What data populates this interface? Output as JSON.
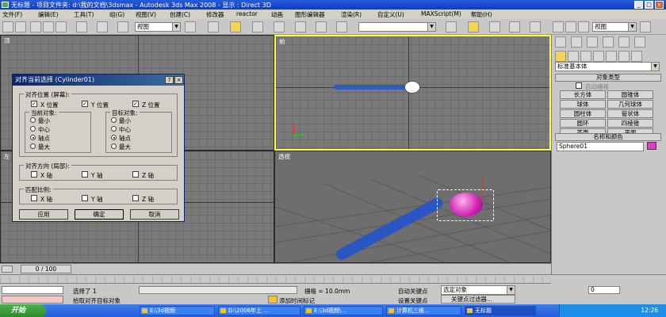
{
  "window": {
    "title": "无标题  - 项目文件夹: d:\\我的文档\\3dsmax    - Autodesk 3ds Max 2008     - 显示 : Direct 3D",
    "min": "_",
    "max": "□",
    "close": "×"
  },
  "menu": [
    "文件(F)",
    "编辑(E)",
    "工具(T)",
    "组(G)",
    "视图(V)",
    "创建(C)",
    "修改器",
    "reactor",
    "动画",
    "图形编辑器",
    "渲染(R)",
    "自定义(U)",
    "MAXScript(M)",
    "帮助(H)"
  ],
  "toolbar": {
    "view_combo": "视图",
    "view_combo_right": "视图"
  },
  "viewports": {
    "top": "顶",
    "front": "前",
    "left": "左",
    "perspective": "透视"
  },
  "command_panel": {
    "category": "标准基本体",
    "object_type_header": "对象类型",
    "autogrid": "自动栅格",
    "objects": [
      "长方体",
      "圆锥体",
      "球体",
      "几何球体",
      "圆柱体",
      "管状体",
      "圆环",
      "四棱锥",
      "茶壶",
      "平面"
    ],
    "name_color_header": "名称和颜色",
    "name_value": "Sphere01",
    "color": "#e040c0"
  },
  "dialog": {
    "title": "对齐当前选择 (Cylinder01)",
    "help": "?",
    "close": "×",
    "align_position": "对齐位置 (屏幕):",
    "x_pos": "X 位置",
    "y_pos": "Y 位置",
    "z_pos": "Z 位置",
    "current_object": "当前对象:",
    "target_object": "目标对象:",
    "current_options": [
      "最小",
      "中心",
      "轴点",
      "最大"
    ],
    "target_options": [
      "最小",
      "中心",
      "轴点",
      "最大"
    ],
    "align_orientation": "对齐方向 (局部):",
    "match_scale": "匹配比例:",
    "x_axis": "X 轴",
    "y_axis": "Y 轴",
    "z_axis": "Z 轴",
    "apply": "应用",
    "ok": "确定",
    "cancel": "取消"
  },
  "status": {
    "frame": "0 / 100",
    "selected": "选择了 1",
    "prompt": "拾取对齐目标对象",
    "grid": "栅格 = 10.0mm",
    "add_tag": "添加时间标记",
    "auto_key": "自动关键点",
    "set_key": "设置关键点",
    "selected_obj": "选定对象",
    "key_filters": "关键点过滤器...",
    "frame_value": "0"
  },
  "taskbar": {
    "start": "开始",
    "tasks": [
      "E:\\3d视频",
      "D:\\2006年上 ...",
      "E:\\3d视频\\...",
      "计算机三维...",
      "无标题"
    ],
    "time": "12:26"
  }
}
